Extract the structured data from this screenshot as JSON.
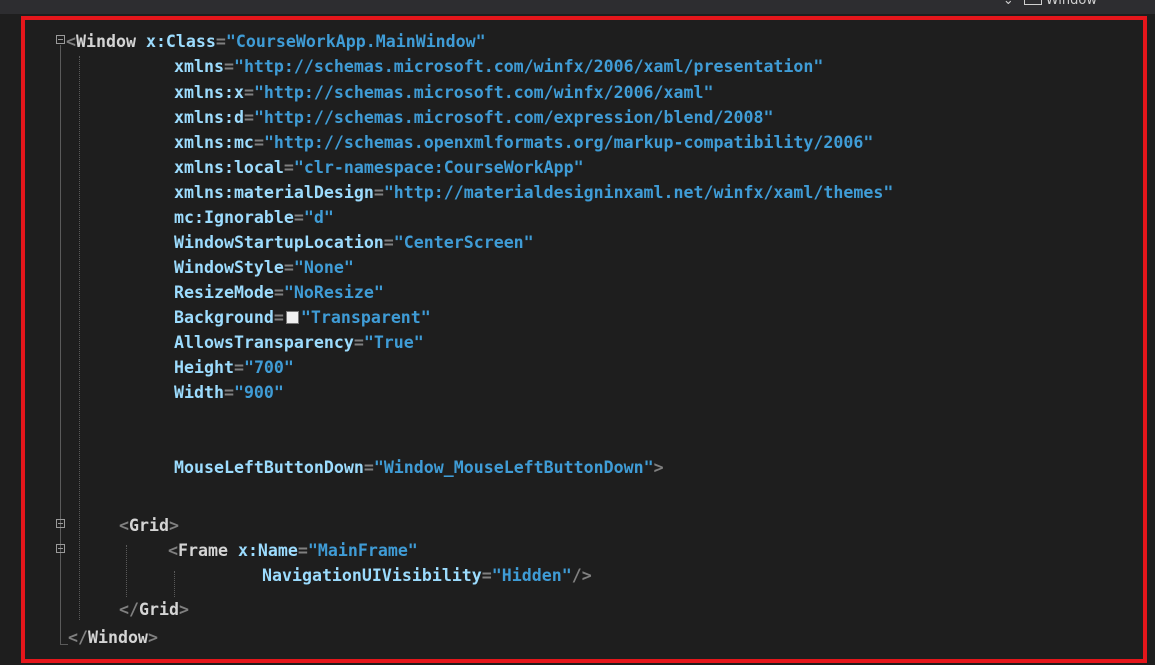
{
  "editor": {
    "nav_label": "Window",
    "accent_border_color": "#e5161b",
    "background_color": "#1e1e1e"
  },
  "code": {
    "window_open": "Window",
    "class_attr": "x:Class",
    "class_val": "\"CourseWorkApp.MainWindow\"",
    "xmlns_attr": "xmlns",
    "xmlns_val": "\"http://schemas.microsoft.com/winfx/2006/xaml/presentation\"",
    "xmlns_x_attr": "xmlns:x",
    "xmlns_x_val": "\"http://schemas.microsoft.com/winfx/2006/xaml\"",
    "xmlns_d_attr": "xmlns:d",
    "xmlns_d_val": "\"http://schemas.microsoft.com/expression/blend/2008\"",
    "xmlns_mc_attr": "xmlns:mc",
    "xmlns_mc_val": "\"http://schemas.openxmlformats.org/markup-compatibility/2006\"",
    "xmlns_local_attr": "xmlns:local",
    "xmlns_local_val": "\"clr-namespace:CourseWorkApp\"",
    "xmlns_md_attr": "xmlns:materialDesign",
    "xmlns_md_val": "\"http://materialdesigninxaml.net/winfx/xaml/themes\"",
    "ignorable_attr": "mc:Ignorable",
    "ignorable_val": "\"d\"",
    "startup_attr": "WindowStartupLocation",
    "startup_val": "\"CenterScreen\"",
    "style_attr": "WindowStyle",
    "style_val": "\"None\"",
    "resize_attr": "ResizeMode",
    "resize_val": "\"NoResize\"",
    "background_attr": "Background",
    "background_val": "\"Transparent\"",
    "transparency_attr": "AllowsTransparency",
    "transparency_val": "\"True\"",
    "height_attr": "Height",
    "height_val": "\"700\"",
    "width_attr": "Width",
    "width_val": "\"900\"",
    "mouse_attr": "MouseLeftButtonDown",
    "mouse_val": "\"Window_MouseLeftButtonDown\"",
    "grid_elem": "Grid",
    "frame_elem": "Frame",
    "frame_name_attr": "x:Name",
    "frame_name_val": "\"MainFrame\"",
    "nav_attr": "NavigationUIVisibility",
    "nav_val": "\"Hidden\"",
    "window_close": "Window"
  }
}
